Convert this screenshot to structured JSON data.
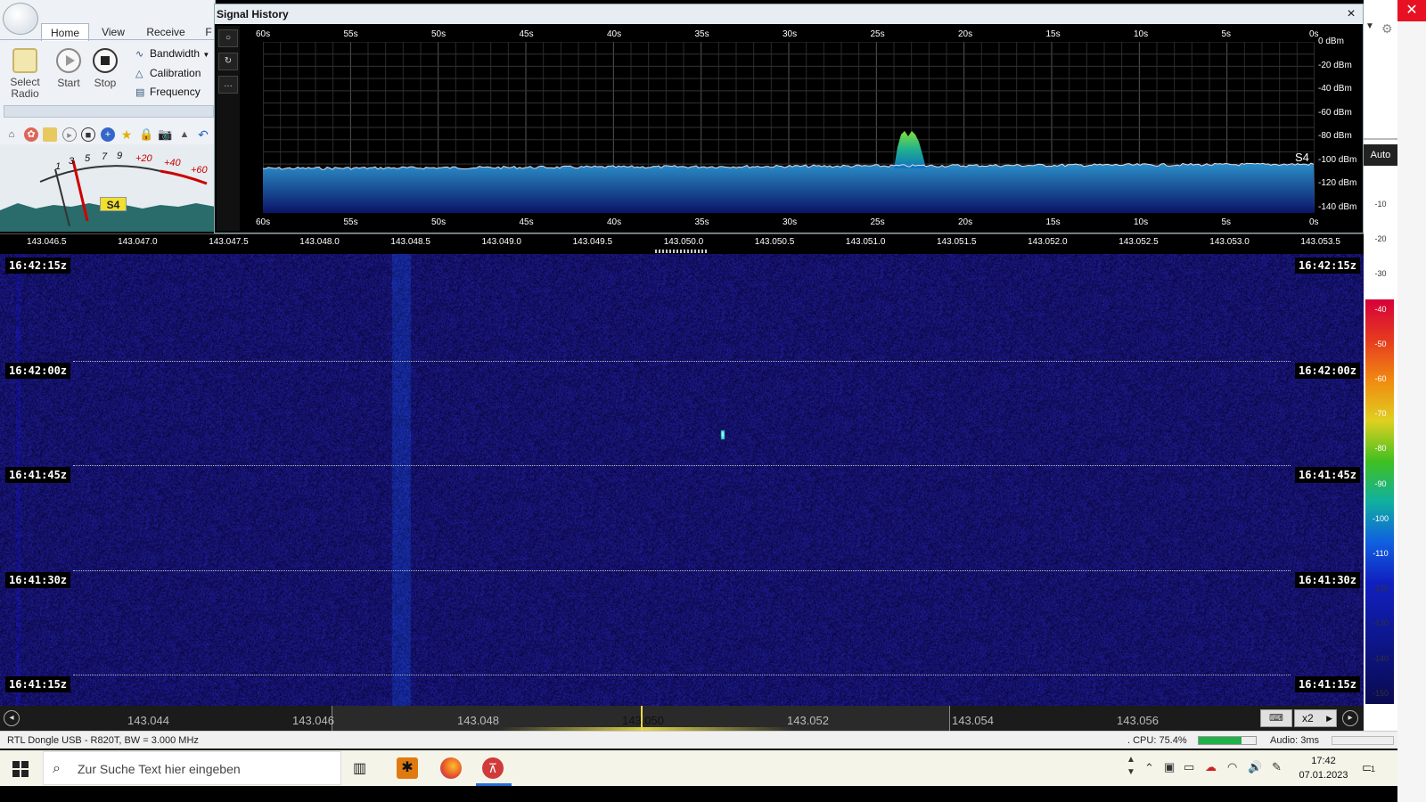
{
  "ribbon": {
    "tabs": [
      "Home",
      "View",
      "Receive",
      "F"
    ],
    "start_label": "Start",
    "stop_label": "Stop",
    "select_radio_label_1": "Select",
    "select_radio_label_2": "Radio",
    "bandwidth_label": "Bandwidth",
    "calibration_label": "Calibration",
    "frequency_label": "Frequency"
  },
  "smeter": {
    "scale": [
      "1",
      "3",
      "5",
      "7",
      "9",
      "+20",
      "+40",
      "+60"
    ],
    "reading": "S4"
  },
  "signal_history": {
    "title": "Signal History",
    "close": "×",
    "time_ticks": [
      "60s",
      "55s",
      "50s",
      "45s",
      "40s",
      "35s",
      "30s",
      "25s",
      "20s",
      "15s",
      "10s",
      "5s",
      "0s"
    ],
    "dbm_ticks": [
      "0 dBm",
      "-20 dBm",
      "-40 dBm",
      "-60 dBm",
      "-80 dBm",
      "-100 dBm",
      "-120 dBm",
      "-140 dBm"
    ],
    "s_label": "S4"
  },
  "top_freq_scale": [
    "143.046.5",
    "143.047.0",
    "143.047.5",
    "143.048.0",
    "143.048.5",
    "143.049.0",
    "143.049.5",
    "143.050.0",
    "143.050.5",
    "143.051.0",
    "143.051.5",
    "143.052.0",
    "143.052.5",
    "143.053.0",
    "143.053.5"
  ],
  "waterfall": {
    "times": [
      "16:42:15z",
      "16:42:00z",
      "16:41:45z",
      "16:41:30z",
      "16:41:15z"
    ]
  },
  "bottom_freq": {
    "ticks": [
      "143.044",
      "143.046",
      "143.048",
      "143.050",
      "143.052",
      "143.054",
      "143.056"
    ],
    "zoom": "x2"
  },
  "colorbar": {
    "auto": "Auto",
    "labels": [
      "-10",
      "-20",
      "-30",
      "-40",
      "-50",
      "-60",
      "-70",
      "-80",
      "-90",
      "-100",
      "-110",
      "-120",
      "-130",
      "-140",
      "-150"
    ]
  },
  "status": {
    "device": "RTL Dongle USB - R820T, BW = 3.000 MHz",
    "cpu": ". CPU: 75.4%",
    "cpu_fraction": 0.754,
    "audio": "Audio: 3ms"
  },
  "taskbar": {
    "search_placeholder": "Zur Suche Text hier eingeben",
    "time": "17:42",
    "date": "07.01.2023",
    "notification_count": "1"
  }
}
